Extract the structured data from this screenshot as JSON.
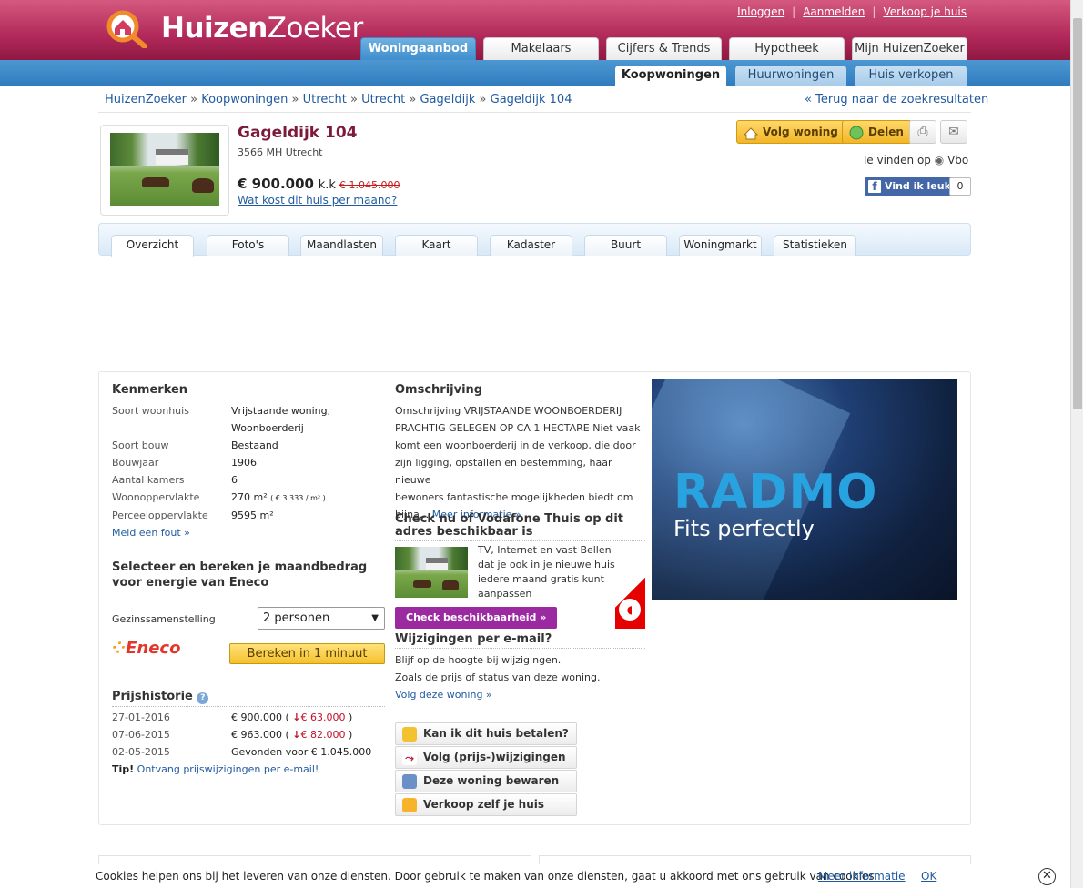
{
  "header": {
    "logo_text_a": "Huizen",
    "logo_text_b": "Zoeker",
    "links": [
      "Inloggen",
      "Aanmelden",
      "Verkoop je huis"
    ],
    "tabs": [
      "Woningaanbod",
      "Makelaars",
      "Cijfers & Trends",
      "Hypotheek",
      "Mijn HuizenZoeker"
    ],
    "subtabs": [
      "Koopwoningen",
      "Huurwoningen",
      "Huis verkopen"
    ]
  },
  "breadcrumb": {
    "items": [
      "HuizenZoeker",
      "Koopwoningen",
      "Utrecht",
      "Utrecht",
      "Gageldijk",
      "Gageldijk 104"
    ],
    "sep": "»",
    "back": "« Terug naar de zoekresultaten"
  },
  "property": {
    "title": "Gageldijk 104",
    "address": "3566 MH Utrecht",
    "price": "€ 900.000",
    "kk": "k.k",
    "old_price": "€ 1.045.000",
    "monthly_link": "Wat kost dit huis per maand?"
  },
  "actions": {
    "follow": "Volg woning",
    "share": "Delen",
    "found_on": "Te vinden op",
    "source": "Vbo",
    "fb_like": "Vind ik leuk",
    "fb_count": "0"
  },
  "detail_tabs": [
    "Overzicht",
    "Foto's",
    "Maandlasten",
    "Kaart",
    "Kadaster",
    "Buurt",
    "Woningmarkt",
    "Statistieken"
  ],
  "kenmerken": {
    "title": "Kenmerken",
    "rows": [
      {
        "k": "Soort woonhuis",
        "v": "Vrijstaande woning,"
      },
      {
        "k": "",
        "v": "Woonboerderij"
      },
      {
        "k": "Soort bouw",
        "v": "Bestaand"
      },
      {
        "k": "Bouwjaar",
        "v": "1906"
      },
      {
        "k": "Aantal kamers",
        "v": "6"
      },
      {
        "k": "Woonoppervlakte",
        "v": "270 m²"
      },
      {
        "k": "Perceeloppervlakte",
        "v": "9595 m²"
      }
    ],
    "sqm_price": "( € 3.333 / m² )",
    "report": "Meld een fout »"
  },
  "energy": {
    "title": "Selecteer en bereken je maandbedrag voor energie van Eneco",
    "label": "Gezinssamenstelling",
    "selected": "2 personen",
    "button": "Bereken in 1 minuut",
    "brand": "Eneco"
  },
  "history": {
    "title": "Prijshistorie",
    "rows": [
      {
        "date": "27-01-2016",
        "price": "€ 900.000",
        "change": "€ 63.000"
      },
      {
        "date": "07-06-2015",
        "price": "€ 963.000",
        "change": "€ 82.000"
      },
      {
        "date": "02-05-2015",
        "price": "Gevonden voor € 1.045.000",
        "change": ""
      }
    ],
    "tip_label": "Tip!",
    "tip_link": "Ontvang prijswijzigingen per e-mail!"
  },
  "omschrijving": {
    "title": "Omschrijving",
    "lines": [
      "Omschrijving VRIJSTAANDE WOONBOERDERIJ",
      "PRACHTIG GELEGEN OP CA 1 HECTARE Niet vaak",
      "komt een woonboerderij in de verkoop, die door",
      "zijn ligging, opstallen en bestemming, haar nieuwe",
      "bewoners fantastische mogelijkheden biedt om",
      "bijna..."
    ],
    "more": "Meer informatie »"
  },
  "vodafone": {
    "title": "Check nu of Vodafone Thuis op dit adres beschikbaar is",
    "lines": [
      "TV, Internet en vast Bellen",
      "dat je ook in je nieuwe huis",
      "iedere maand gratis kunt",
      "aanpassen"
    ],
    "button": "Check beschikbaarheid »"
  },
  "email": {
    "title": "Wijzigingen per e-mail?",
    "lines": [
      "Blijf op de hoogte bij wijzigingen.",
      "Zoals de prijs of status van deze woning."
    ],
    "link": "Volg deze woning »"
  },
  "buttons": [
    "Kan ik dit huis betalen?",
    "Volg (prijs-)wijzigingen",
    "Deze woning bewaren",
    "Verkoop zelf je huis"
  ],
  "ad": {
    "brand": "RADMO",
    "tagline": "Fits perfectly"
  },
  "cookie": {
    "text": "Cookies helpen ons bij het leveren van onze diensten. Door gebruik te maken van onze diensten, gaat u akkoord met ons gebruik van cookies.",
    "link": "Meer informatie",
    "ok": "OK"
  }
}
